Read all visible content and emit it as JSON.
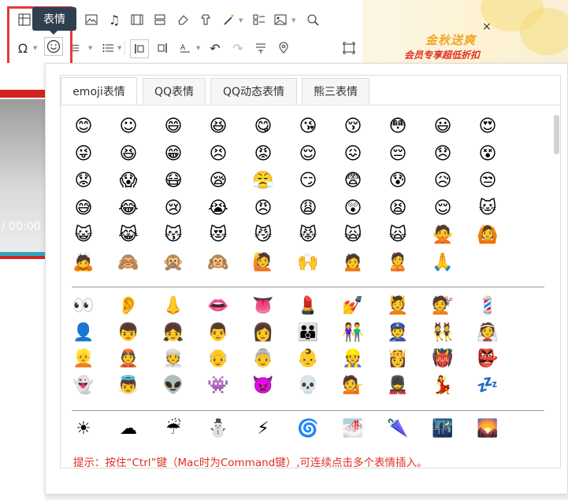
{
  "tooltip": "表情",
  "video": {
    "time": "/ 00:00"
  },
  "ad": {
    "title": "金秋送爽",
    "subtitle": "会员专享超低折扣",
    "close": "×"
  },
  "tabs": [
    "emoji表情",
    "QQ表情",
    "QQ动态表情",
    "熊三表情"
  ],
  "active_tab": 0,
  "emoji_rows_group1": [
    [
      "😊",
      "☺",
      "😄",
      "😆",
      "😋",
      "😘",
      "😚",
      "😳",
      "😃",
      "😍"
    ],
    [
      "😜",
      "😆",
      "😁",
      "😣",
      "😡",
      "😌",
      "😖",
      "😔",
      "😞",
      "😵"
    ],
    [
      "😟",
      "😱",
      "😷",
      "😪",
      "😤",
      "😏",
      "😨",
      "😰",
      "😥",
      "😒"
    ],
    [
      "😅",
      "😂",
      "😢",
      "😭",
      "😠",
      "😩",
      "😲",
      "😫",
      "😌",
      "🐱"
    ],
    [
      "😺",
      "😹",
      "😽",
      "😻",
      "😼",
      "😾",
      "🙀",
      "🙀",
      "🙅",
      "🙆"
    ],
    [
      "🙇",
      "🙈",
      "🙊",
      "🙉",
      "🙋",
      "🙌",
      "🙍",
      "🙎",
      "🙏"
    ]
  ],
  "emoji_rows_group2": [
    [
      "👀",
      "👂",
      "👃",
      "👄",
      "👅",
      "💄",
      "💅",
      "💆",
      "💇",
      "💈"
    ],
    [
      "👤",
      "👦",
      "👧",
      "👨",
      "👩",
      "👪",
      "👫",
      "👮",
      "👯",
      "👰"
    ],
    [
      "👱",
      "👲",
      "👳",
      "👴",
      "👵",
      "👶",
      "👷",
      "👸",
      "👹",
      "👺"
    ],
    [
      "👻",
      "👼",
      "👽",
      "👾",
      "👿",
      "💀",
      "💁",
      "💂",
      "💃",
      "💤"
    ]
  ],
  "emoji_rows_group3": [
    [
      "☀",
      "☁",
      "☔",
      "⛄",
      "⚡",
      "🌀",
      "🌁",
      "🌂",
      "🌃",
      "🌄"
    ]
  ],
  "tip": "提示：按住“Ctrl”键（Mac时为Command键）,可连续点击多个表情插入。"
}
